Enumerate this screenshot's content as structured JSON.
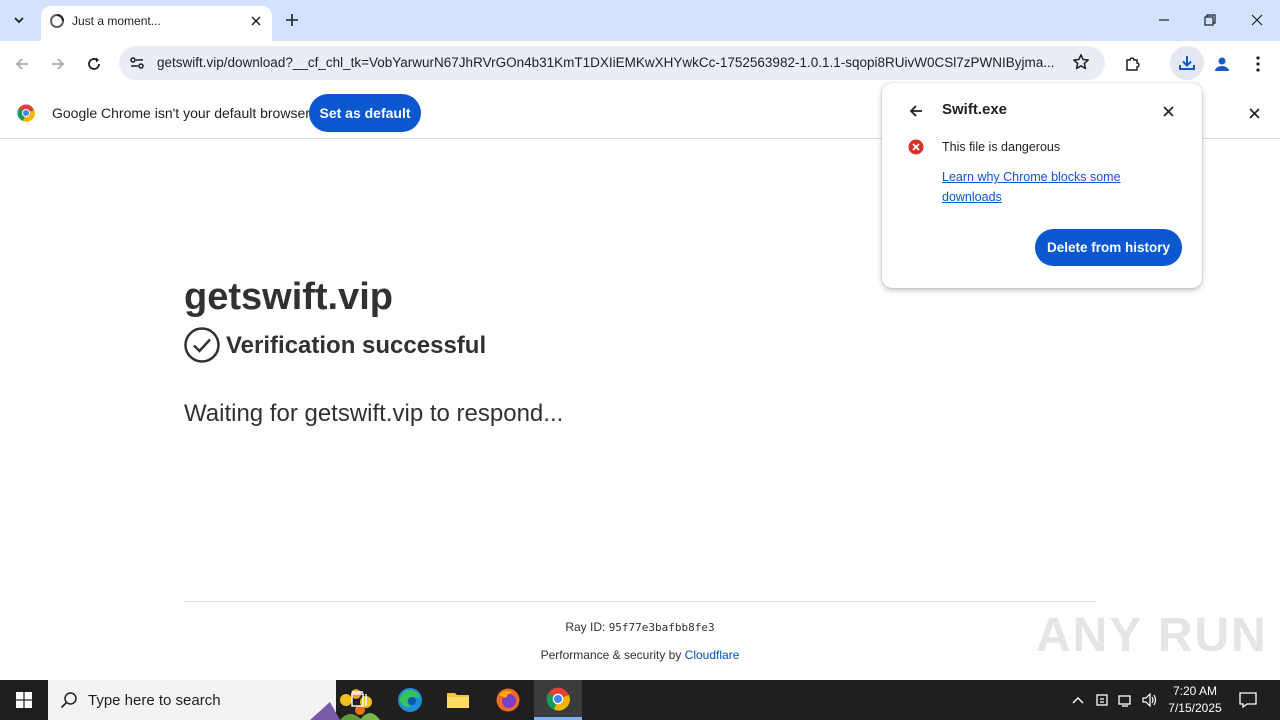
{
  "browser": {
    "tab_title": "Just a moment...",
    "url": "getswift.vip/download?__cf_chl_tk=VobYarwurN67JhRVrGOn4b31KmT1DXIiEMKwXHYwkCc-1752563982-1.0.1.1-sqopi8RUivW0CSl7zPWNIByjma..."
  },
  "infobar": {
    "message": "Google Chrome isn't your default browser",
    "set_default_label": "Set as default"
  },
  "page": {
    "site_name": "getswift.vip",
    "verification": "Verification successful",
    "waiting": "Waiting for getswift.vip to respond...",
    "ray_label": "Ray ID: ",
    "ray_id": "95f77e3bafbb8fe3",
    "perf_label": "Performance & security by ",
    "perf_link": "Cloudflare"
  },
  "download_bubble": {
    "filename": "Swift.exe",
    "status": "This file is dangerous",
    "learn_link": "Learn why Chrome blocks some downloads",
    "delete_label": "Delete from history"
  },
  "watermark": "ANY RUN",
  "taskbar": {
    "search_placeholder": "Type here to search",
    "time": "7:20 AM",
    "date": "7/15/2025"
  },
  "colors": {
    "accent": "#0b57d0",
    "danger": "#d93025",
    "titlebar": "#d3e3fd"
  },
  "icons": [
    "tab-search-icon",
    "favicon-icon",
    "close-icon",
    "plus-icon",
    "minimize-icon",
    "restore-icon",
    "back-icon",
    "forward-icon",
    "reload-icon",
    "site-info-icon",
    "star-icon",
    "extensions-icon",
    "download-icon",
    "profile-icon",
    "menu-icon",
    "chrome-logo-icon",
    "check-circle-icon",
    "error-icon",
    "windows-start-icon",
    "search-icon"
  ]
}
